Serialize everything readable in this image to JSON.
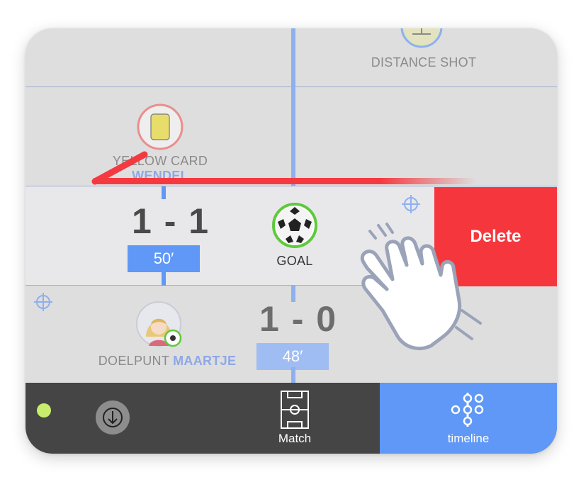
{
  "events": {
    "distance_shot": {
      "label": "DISTANCE SHOT"
    },
    "yellow_card": {
      "label": "YELLOW CARD",
      "player": "WENDEL"
    },
    "goal_swiped": {
      "score": "1 - 1",
      "minute": "50′",
      "label": "GOAL"
    },
    "goal_prev": {
      "label_prefix": "DOELPUNT",
      "player": "MAARTJE",
      "score": "1 - 0",
      "minute": "48′"
    }
  },
  "swipe_action": {
    "delete_label": "Delete"
  },
  "bottom_bar": {
    "match_label": "Match",
    "timeline_label": "timeline",
    "status_color": "#c8ec6c"
  },
  "colors": {
    "accent_blue": "#5f98f6",
    "delete_red": "#f5373d",
    "goal_green": "#5fc93d",
    "yellow_card": "#e8dd6b"
  },
  "icons": [
    "target-icon",
    "yellow-card-icon",
    "soccer-ball-icon",
    "avatar",
    "arrow-down-icon",
    "pitch-icon",
    "timeline-icon",
    "hand-swipe-icon"
  ]
}
